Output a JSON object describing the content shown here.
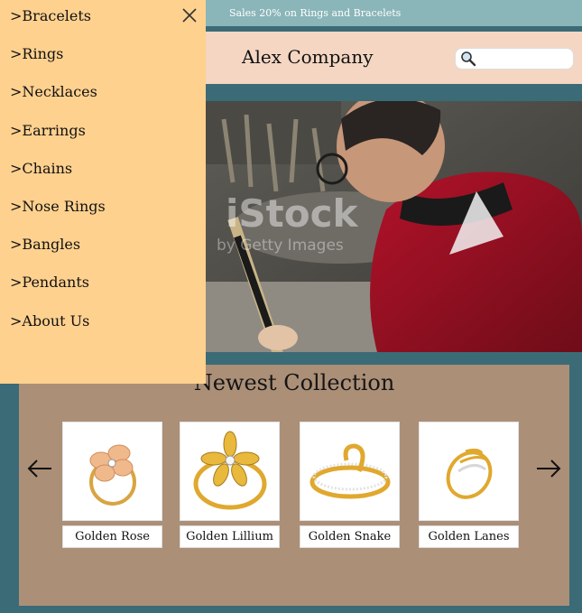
{
  "topbar": {
    "promo": "Sales 20% on Rings and Bracelets"
  },
  "header": {
    "brand": "Alex Company",
    "search_placeholder": "",
    "search_icon": "magnifier-icon"
  },
  "hero": {
    "watermark": "iStock",
    "watermark_sub": "by Getty Images"
  },
  "collection": {
    "title": "Newest Collection",
    "products": [
      {
        "name": "Golden Rose"
      },
      {
        "name": "Golden Lillium"
      },
      {
        "name": "Golden Snake"
      },
      {
        "name": "Golden Lanes"
      }
    ],
    "prev_icon": "arrow-left-icon",
    "next_icon": "arrow-right-icon"
  },
  "sidenav": {
    "close_icon": "close-icon",
    "items": [
      {
        "label": ">Bracelets"
      },
      {
        "label": ">Rings"
      },
      {
        "label": ">Necklaces"
      },
      {
        "label": ">Earrings"
      },
      {
        "label": ">Chains"
      },
      {
        "label": ">Nose Rings"
      },
      {
        "label": ">Bangles"
      },
      {
        "label": ">Pendants"
      },
      {
        "label": ">About Us"
      }
    ]
  },
  "colors": {
    "teal": "#3b6b77",
    "topbar": "#8ab5b9",
    "header": "#f4d6c2",
    "panel": "#ab8f77",
    "sidenav": "#ffd18f",
    "gold": "#e0a82e"
  }
}
